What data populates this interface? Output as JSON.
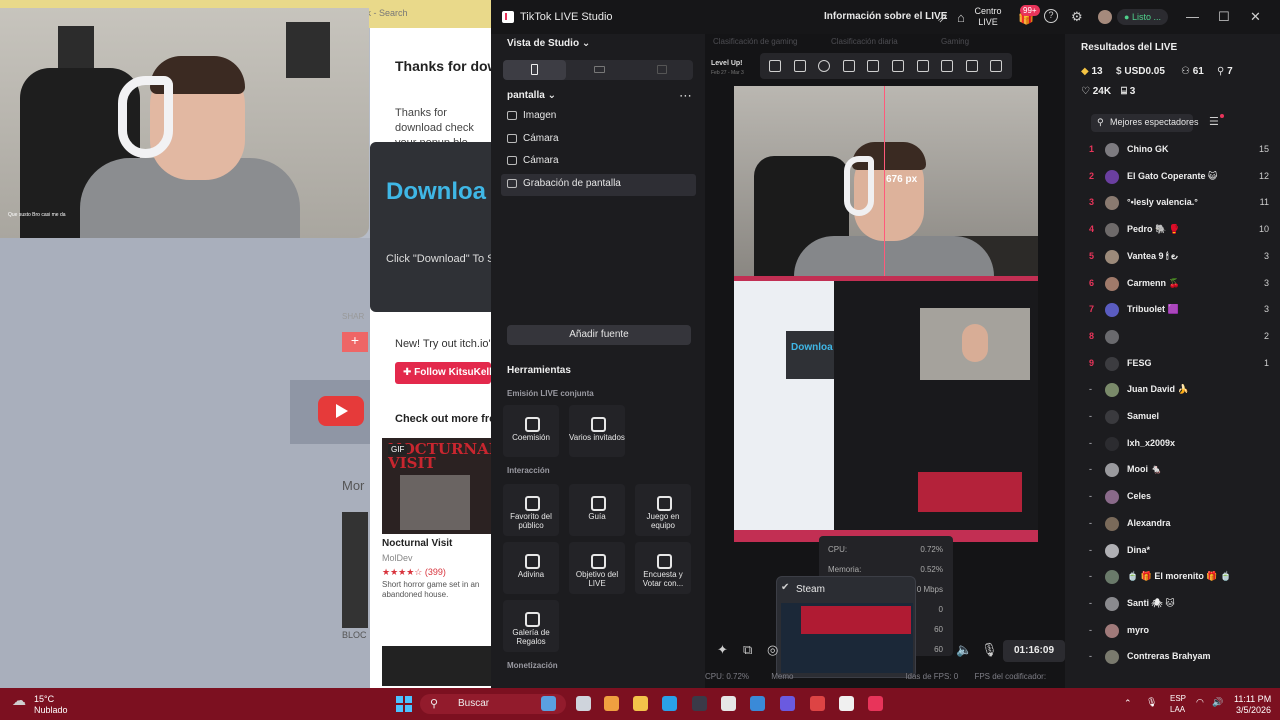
{
  "webpage": {
    "url_fragment": "ick - Search",
    "heading": "Thanks for dow",
    "paragraph": "Thanks for download check your popup blo",
    "download_title": "Downloa",
    "download_sub": "Click \"Download\" To S",
    "new_text": "New! Try out itch.io's",
    "follow_label": "Follow KitsuKell",
    "checkout": "Check out more from",
    "more_label": "Mor",
    "share_label": "SHAR",
    "blog_label": "BLOC",
    "game": {
      "gif": "GIF",
      "thumb_title": "NOCTURNAL VISIT",
      "name": "Nocturnal Visit",
      "dev": "MolDev",
      "rating": "★★★★☆ (399)",
      "desc": "Short horror game set in an abandoned house."
    }
  },
  "webcam": {
    "caption": "Que susto Bro casi me da"
  },
  "studio": {
    "title": "TikTok LIVE Studio",
    "info_label": "Información sobre el LIVE",
    "centro_label": "Centro LIVE",
    "notif_badge": "99+",
    "status": "Listo ...",
    "view_mode": "Vista de Studio",
    "scene_name": "pantalla",
    "sources": [
      {
        "label": "Imagen",
        "icon": "image-icon"
      },
      {
        "label": "Cámara",
        "icon": "camera-icon"
      },
      {
        "label": "Cámara",
        "icon": "camera-icon"
      },
      {
        "label": "Grabación de pantalla",
        "icon": "monitor-icon",
        "selected": true
      }
    ],
    "add_source": "Añadir fuente",
    "tools_title": "Herramientas",
    "joint_title": "Emisión LIVE conjunta",
    "joint_tiles": [
      "Coemisión",
      "Varios invitados"
    ],
    "interaction_title": "Interacción",
    "interaction_tiles": [
      "Favorito del público",
      "Guía",
      "Juego en equipo",
      "Adivina",
      "Objetivo del LIVE",
      "Encuesta y Votar con...",
      "Galería de Regalos"
    ],
    "monetization_title": "Monetización",
    "preview_tabs": [
      "Clasificación de gaming",
      "Clasificación diaria",
      "Gaming"
    ],
    "level_label": "Level Up!",
    "level_sub": "Feb 27 - Mar 3",
    "guide_px": "676 px",
    "nested_download": "Downloa",
    "stats": [
      {
        "label": "CPU:",
        "value": "0.72%"
      },
      {
        "label": "Memoria:",
        "value": "0.52%"
      },
      {
        "label": "",
        "value": "0 Mbps"
      },
      {
        "label": "",
        "value": "0"
      },
      {
        "label": "",
        "value": "60"
      },
      {
        "label": "",
        "value": "60"
      }
    ],
    "steam_label": "Steam",
    "timer": "01:16:09",
    "status_cpu": "CPU: 0.72%",
    "status_mem": "Memo",
    "status_fps": "ldas de FPS: 0",
    "status_codec": "FPS del codificador:"
  },
  "results": {
    "title": "Resultados del LIVE",
    "row1": [
      {
        "icon": "diamond-icon",
        "value": "13"
      },
      {
        "icon": "dollar-icon",
        "value": "USD0.05"
      },
      {
        "icon": "users-icon",
        "value": "61"
      },
      {
        "icon": "user-plus-icon",
        "value": "7"
      }
    ],
    "row2": [
      {
        "icon": "heart-icon",
        "value": "24K"
      },
      {
        "icon": "gift-icon",
        "value": "3"
      }
    ],
    "top_label": "Mejores espectadores",
    "viewers": [
      {
        "rank": "1",
        "name": "Chino GK",
        "score": "15"
      },
      {
        "rank": "2",
        "name": "El Gato Coperante 😺",
        "score": "12"
      },
      {
        "rank": "3",
        "name": "°•lesly valencia.°",
        "score": "11"
      },
      {
        "rank": "4",
        "name": "Pedro 🐘 🥊",
        "score": "10"
      },
      {
        "rank": "5",
        "name": "Vantea 9 🕯 ౿",
        "score": "3"
      },
      {
        "rank": "6",
        "name": "Carmenn 🍒",
        "score": "3"
      },
      {
        "rank": "7",
        "name": "Tribuolet 🟪",
        "score": "3"
      },
      {
        "rank": "8",
        "name": "",
        "score": "2"
      },
      {
        "rank": "9",
        "name": "FESG",
        "score": "1"
      },
      {
        "rank": "-",
        "name": "Juan David 🍌",
        "score": ""
      },
      {
        "rank": "-",
        "name": "Samuel",
        "score": ""
      },
      {
        "rank": "-",
        "name": "lxh_x2009x",
        "score": ""
      },
      {
        "rank": "-",
        "name": "Mooi 🐁",
        "score": ""
      },
      {
        "rank": "-",
        "name": "Celes",
        "score": ""
      },
      {
        "rank": "-",
        "name": "Alexandra",
        "score": ""
      },
      {
        "rank": "-",
        "name": "Dina*",
        "score": ""
      },
      {
        "rank": "-",
        "name": "🍵 🎁 El morenito 🎁 🍵",
        "score": ""
      },
      {
        "rank": "-",
        "name": "Santi 🕷 🐱",
        "score": ""
      },
      {
        "rank": "-",
        "name": "myro",
        "score": ""
      },
      {
        "rank": "-",
        "name": "Contreras Brahyam",
        "score": ""
      }
    ]
  },
  "taskbar": {
    "temp": "15°C",
    "weather": "Nublado",
    "search": "Buscar",
    "lang1": "ESP",
    "lang2": "LAA",
    "time": "11:11 PM",
    "date": "3/5/2026"
  }
}
